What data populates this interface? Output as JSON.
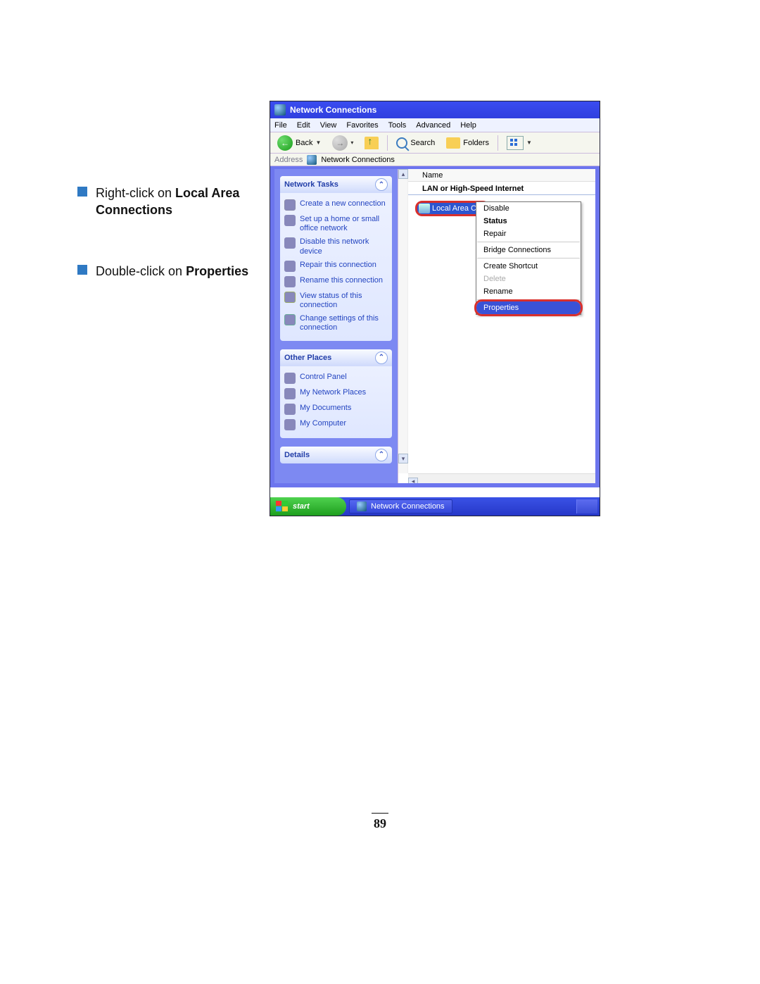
{
  "instructions": {
    "item1_prefix": "Right-click on ",
    "item1_bold": "Local Area Connections",
    "item2_prefix": "Double-click on ",
    "item2_bold": "Properties"
  },
  "window": {
    "title": "Network Connections",
    "menu": {
      "file": "File",
      "edit": "Edit",
      "view": "View",
      "favorites": "Favorites",
      "tools": "Tools",
      "advanced": "Advanced",
      "help": "Help"
    },
    "toolbar": {
      "back": "Back",
      "search": "Search",
      "folders": "Folders"
    },
    "address": {
      "label": "Address",
      "value": "Network Connections"
    }
  },
  "sidepanel": {
    "network_tasks_title": "Network Tasks",
    "other_places_title": "Other Places",
    "details_title": "Details",
    "tasks": {
      "create": "Create a new connection",
      "setup": "Set up a home or small office network",
      "disable": "Disable this network device",
      "repair": "Repair this connection",
      "rename": "Rename this connection",
      "viewstatus": "View status of this connection",
      "changeset": "Change settings of this connection"
    },
    "places": {
      "control_panel": "Control Panel",
      "my_network_places": "My Network Places",
      "my_documents": "My Documents",
      "my_computer": "My Computer"
    }
  },
  "main_pane": {
    "column_name": "Name",
    "group": "LAN or High-Speed Internet",
    "item_label": "Local Area Con"
  },
  "context_menu": {
    "disable": "Disable",
    "status": "Status",
    "repair": "Repair",
    "bridge": "Bridge Connections",
    "shortcut": "Create Shortcut",
    "delete": "Delete",
    "rename": "Rename",
    "properties": "Properties"
  },
  "taskbar": {
    "start": "start",
    "task_label": "Network Connections"
  },
  "page_number": "89"
}
